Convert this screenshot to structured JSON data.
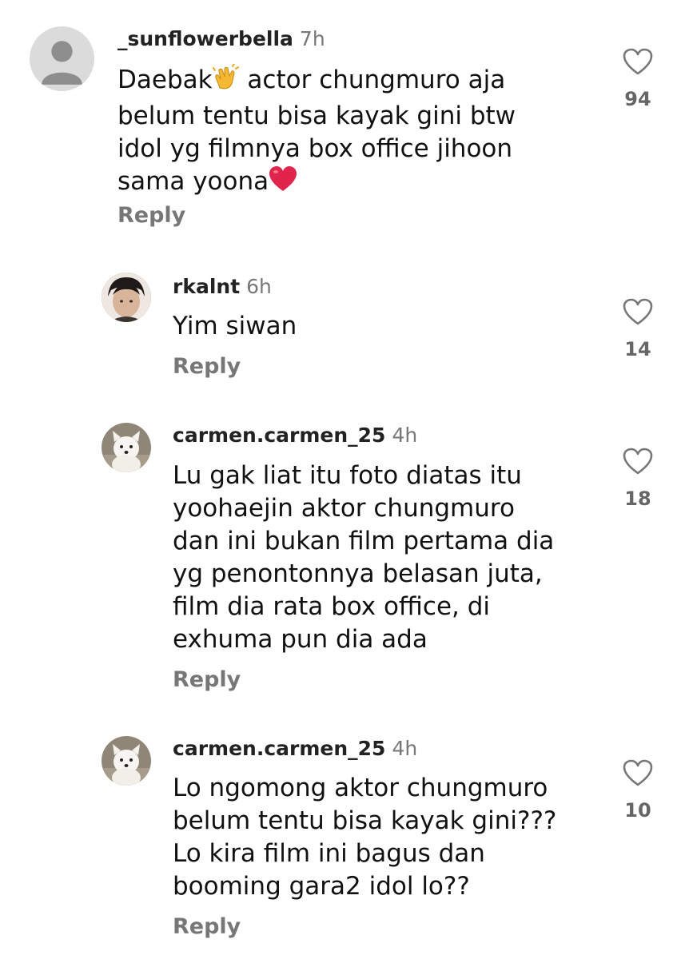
{
  "comments": [
    {
      "username": "_sunflowerbella",
      "time": "7h",
      "text_lines": [
        "Daebak",
        " actor chungmuro aja",
        "belum tentu bisa kayak gini btw",
        "idol yg filmnya box office jihoon",
        "sama yoona"
      ],
      "reply_label": "Reply",
      "likes": "94",
      "avatar": "default-avatar-icon"
    },
    {
      "username": "rkalnt",
      "time": "6h",
      "text_lines": [
        "Yim siwan"
      ],
      "reply_label": "Reply",
      "likes": "14",
      "avatar": "user-photo"
    },
    {
      "username": "carmen.carmen_25",
      "time": "4h",
      "text_lines": [
        "Lu gak liat itu foto diatas itu",
        "yoohaejin aktor chungmuro",
        "dan ini bukan film pertama dia",
        "yg penontonnya belasan juta,",
        "film dia rata box office, di",
        "exhuma pun dia ada"
      ],
      "reply_label": "Reply",
      "likes": "18",
      "avatar": "white-dog-photo"
    },
    {
      "username": "carmen.carmen_25",
      "time": "4h",
      "text_lines": [
        "Lo ngomong aktor chungmuro",
        "belum tentu bisa kayak gini???",
        "Lo kira film ini bagus dan",
        "booming gara2 idol lo??"
      ],
      "reply_label": "Reply",
      "likes": "10",
      "avatar": "white-dog-photo"
    }
  ],
  "colors": {
    "text": "#111111",
    "muted": "#777777",
    "heart": "#e0244b"
  }
}
